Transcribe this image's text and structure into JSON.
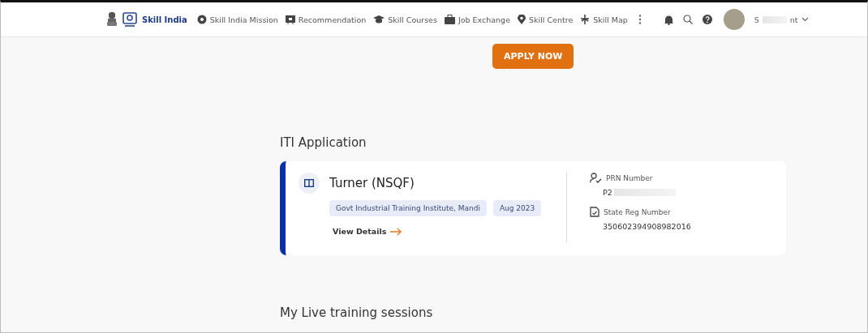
{
  "header": {
    "logo_text": "Skill India",
    "nav": [
      {
        "label": "Skill India Mission",
        "kind": "mission"
      },
      {
        "label": "Recommendation",
        "kind": "recommendation"
      },
      {
        "label": "Skill Courses",
        "kind": "courses"
      },
      {
        "label": "Job Exchange",
        "kind": "jobs"
      },
      {
        "label": "Skill Centre",
        "kind": "centre"
      },
      {
        "label": "Skill Map",
        "kind": "map"
      }
    ],
    "user": {
      "name_start": "S",
      "name_end": "nt"
    }
  },
  "apply_button": "APPLY NOW",
  "section_title": "ITI Application",
  "application": {
    "course": "Turner (NSQF)",
    "tags": [
      "Govt Industrial Training Institute, Mandi",
      "Aug 2023"
    ],
    "link": "View Details",
    "fields": [
      {
        "kind": "prn",
        "label": "PRN Number",
        "value": "P2",
        "redacted": true
      },
      {
        "kind": "reg",
        "label": "State Reg Number",
        "value": "350602394908982016",
        "redacted": false
      }
    ]
  },
  "next_section_title": "My Live training sessions"
}
